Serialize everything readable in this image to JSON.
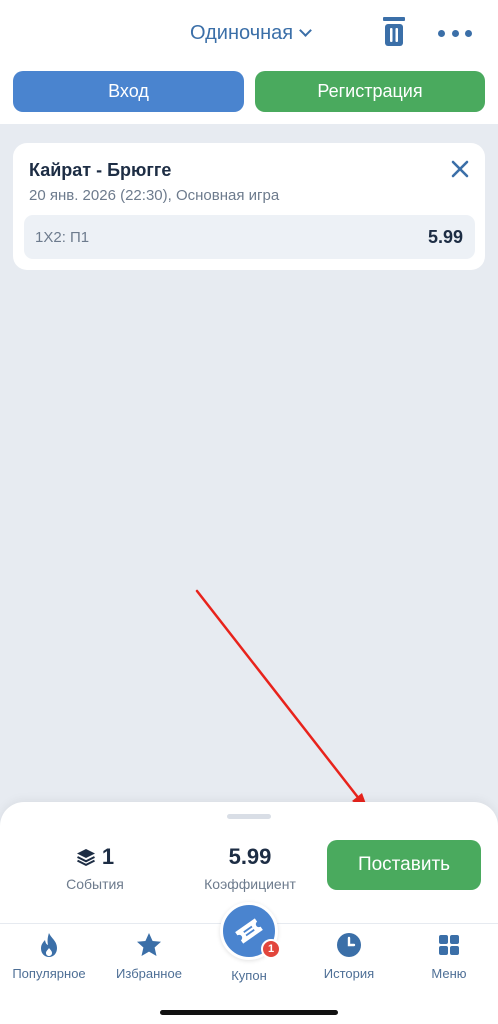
{
  "header": {
    "bet_type_label": "Одиночная",
    "trash_icon": "trash-icon",
    "more_icon": "more-dots-icon"
  },
  "auth": {
    "login_label": "Вход",
    "register_label": "Регистрация"
  },
  "bet": {
    "match": "Кайрат - Брюгге",
    "meta": "20 янв. 2026 (22:30), Основная игра",
    "outcome": "1X2: П1",
    "odds": "5.99"
  },
  "summary": {
    "events_count": "1",
    "events_label": "События",
    "odds_value": "5.99",
    "odds_label": "Коэффициент",
    "place_bet_label": "Поставить"
  },
  "nav": {
    "items": [
      {
        "label": "Популярное",
        "icon": "flame-icon"
      },
      {
        "label": "Избранное",
        "icon": "star-icon"
      },
      {
        "label": "Купон",
        "icon": "ticket-icon",
        "badge": "1"
      },
      {
        "label": "История",
        "icon": "clock-icon"
      },
      {
        "label": "Меню",
        "icon": "grid-icon"
      }
    ]
  },
  "colors": {
    "accent_blue": "#4a84cf",
    "accent_green": "#4aaa5e",
    "text_dark": "#1d2d44",
    "text_muted": "#6d7b8d",
    "nav_icon": "#3b6fa8",
    "background": "#e7ebf1",
    "badge_red": "#e2463c",
    "annotation_arrow": "#e8231c"
  }
}
